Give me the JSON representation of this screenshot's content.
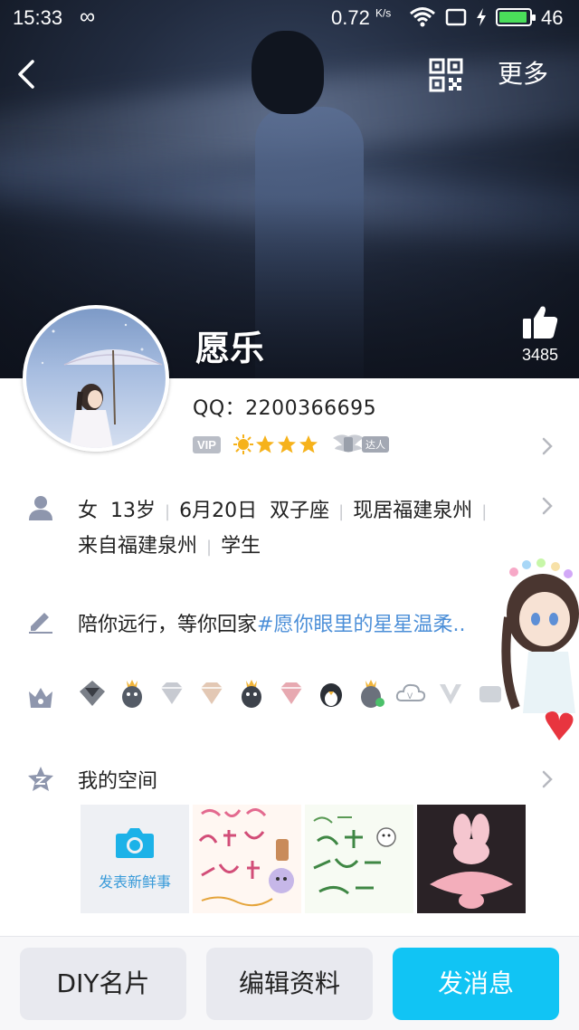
{
  "status_bar": {
    "time": "15:33",
    "speed": "0.72",
    "speed_unit": "K/s",
    "battery": "46",
    "battery_color": "#4ade5a"
  },
  "header": {
    "back_icon": "chevron-left-icon",
    "qr_icon": "qr-code-icon",
    "more_label": "更多"
  },
  "profile": {
    "nickname": "愿乐",
    "likes": "3485",
    "qq": "QQ：2200366695",
    "vip_label": "VIP",
    "daren_label": "达人",
    "gender": "女",
    "age": "13岁",
    "birthday": "6月20日",
    "zodiac": "双子座",
    "residence": "现居福建泉州",
    "hometown": "来自福建泉州",
    "occupation": "学生",
    "signature": "陪你远行，等你回家",
    "signature_tag": "#愿你眼里的星星温柔.."
  },
  "space": {
    "title": "我的空间",
    "post_label": "发表新鲜事"
  },
  "bottom_bar": {
    "diy_label": "DIY名片",
    "edit_label": "编辑资料",
    "message_label": "发消息",
    "accent": "#11c4f4"
  }
}
